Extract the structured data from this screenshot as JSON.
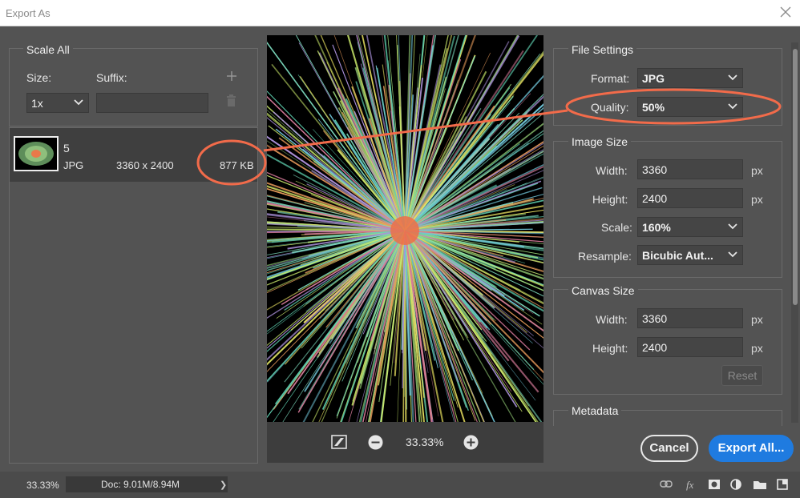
{
  "window": {
    "title": "Export As"
  },
  "scale_all": {
    "title": "Scale All",
    "size_label": "Size:",
    "suffix_label": "Suffix:",
    "size_value": "1x",
    "suffix_value": ""
  },
  "asset": {
    "name": "5",
    "format": "JPG",
    "dimensions": "3360 x 2400",
    "file_size": "877 KB"
  },
  "preview": {
    "zoom": "33.33%"
  },
  "file_settings": {
    "title": "File Settings",
    "format_label": "Format:",
    "format_value": "JPG",
    "quality_label": "Quality:",
    "quality_value": "50%"
  },
  "image_size": {
    "title": "Image Size",
    "width_label": "Width:",
    "width_value": "3360",
    "height_label": "Height:",
    "height_value": "2400",
    "scale_label": "Scale:",
    "scale_value": "160%",
    "resample_label": "Resample:",
    "resample_value": "Bicubic Aut...",
    "unit": "px"
  },
  "canvas_size": {
    "title": "Canvas Size",
    "width_label": "Width:",
    "width_value": "3360",
    "height_label": "Height:",
    "height_value": "2400",
    "unit": "px",
    "reset_label": "Reset"
  },
  "metadata": {
    "title": "Metadata"
  },
  "buttons": {
    "cancel": "Cancel",
    "export": "Export All..."
  },
  "status_bar": {
    "zoom": "33.33%",
    "doc": "Doc: 9.01M/8.94M",
    "arrow": "❯"
  },
  "colors": {
    "accent_blue": "#1f7be0",
    "annotation": "#f26b4a",
    "panel": "#535353"
  }
}
